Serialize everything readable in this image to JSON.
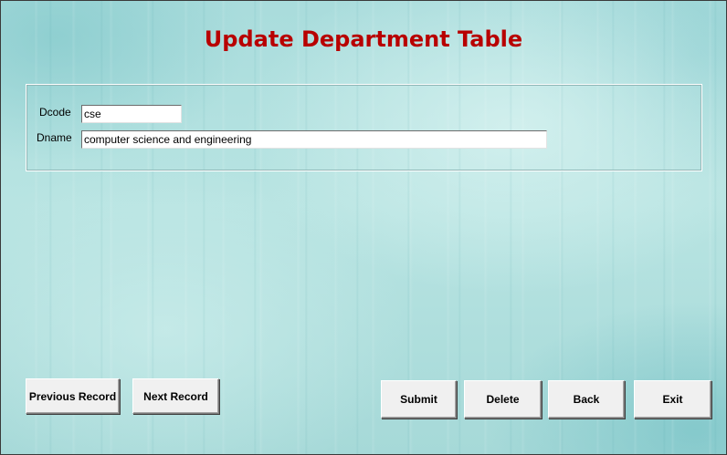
{
  "title": "Update Department Table",
  "form": {
    "dcode_label": "Dcode",
    "dcode_value": "cse",
    "dname_label": "Dname",
    "dname_value": "computer science and engineering"
  },
  "buttons": {
    "previous_record": "Previous Record",
    "next_record": "Next Record",
    "submit": "Submit",
    "delete": "Delete",
    "back": "Back",
    "exit": "Exit"
  },
  "colors": {
    "title": "#b80000",
    "background": "#b8e4e2",
    "button_face": "#f0f0f0"
  }
}
